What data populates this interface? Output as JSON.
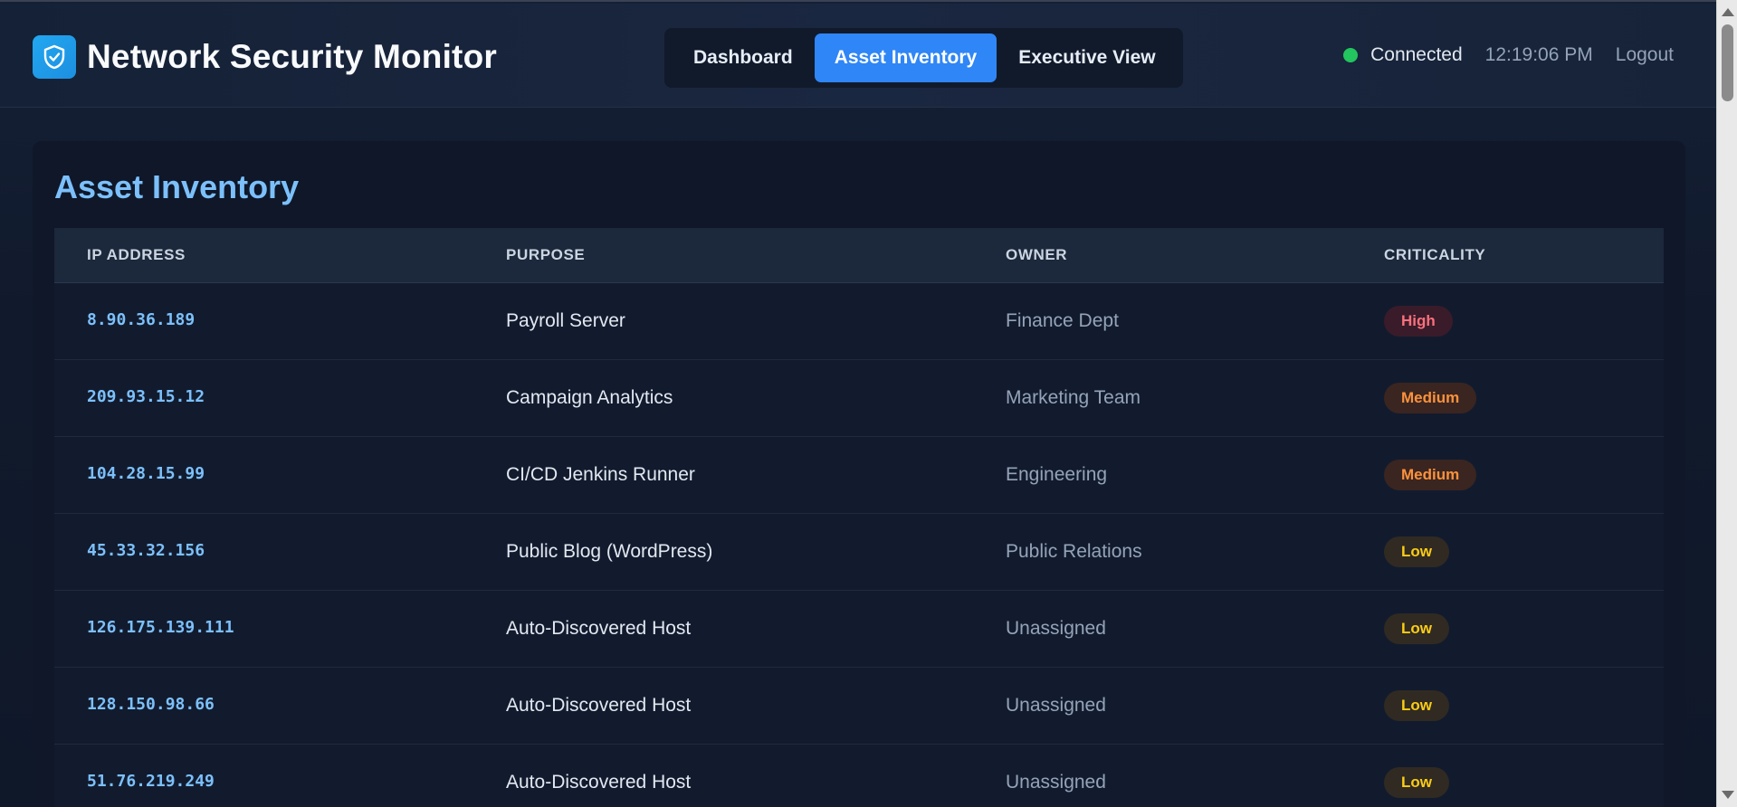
{
  "header": {
    "app_title": "Network Security Monitor",
    "logo_icon": "shield-check-icon",
    "nav": [
      {
        "label": "Dashboard",
        "active": false
      },
      {
        "label": "Asset Inventory",
        "active": true
      },
      {
        "label": "Executive View",
        "active": false
      }
    ],
    "status": {
      "label": "Connected",
      "color": "#22c55e"
    },
    "clock": "12:19:06 PM",
    "logout_label": "Logout"
  },
  "main": {
    "title": "Asset Inventory",
    "columns": [
      "IP ADDRESS",
      "PURPOSE",
      "OWNER",
      "CRITICALITY"
    ],
    "rows": [
      {
        "ip": "8.90.36.189",
        "purpose": "Payroll Server",
        "owner": "Finance Dept",
        "criticality": "High"
      },
      {
        "ip": "209.93.15.12",
        "purpose": "Campaign Analytics",
        "owner": "Marketing Team",
        "criticality": "Medium"
      },
      {
        "ip": "104.28.15.99",
        "purpose": "CI/CD Jenkins Runner",
        "owner": "Engineering",
        "criticality": "Medium"
      },
      {
        "ip": "45.33.32.156",
        "purpose": "Public Blog (WordPress)",
        "owner": "Public Relations",
        "criticality": "Low"
      },
      {
        "ip": "126.175.139.111",
        "purpose": "Auto-Discovered Host",
        "owner": "Unassigned",
        "criticality": "Low"
      },
      {
        "ip": "128.150.98.66",
        "purpose": "Auto-Discovered Host",
        "owner": "Unassigned",
        "criticality": "Low"
      },
      {
        "ip": "51.76.219.249",
        "purpose": "Auto-Discovered Host",
        "owner": "Unassigned",
        "criticality": "Low"
      }
    ]
  },
  "colors": {
    "accent": "#2f86f6",
    "title": "#7cc0fb",
    "high": "#f8717c",
    "medium": "#fb923c",
    "low": "#facc15"
  }
}
